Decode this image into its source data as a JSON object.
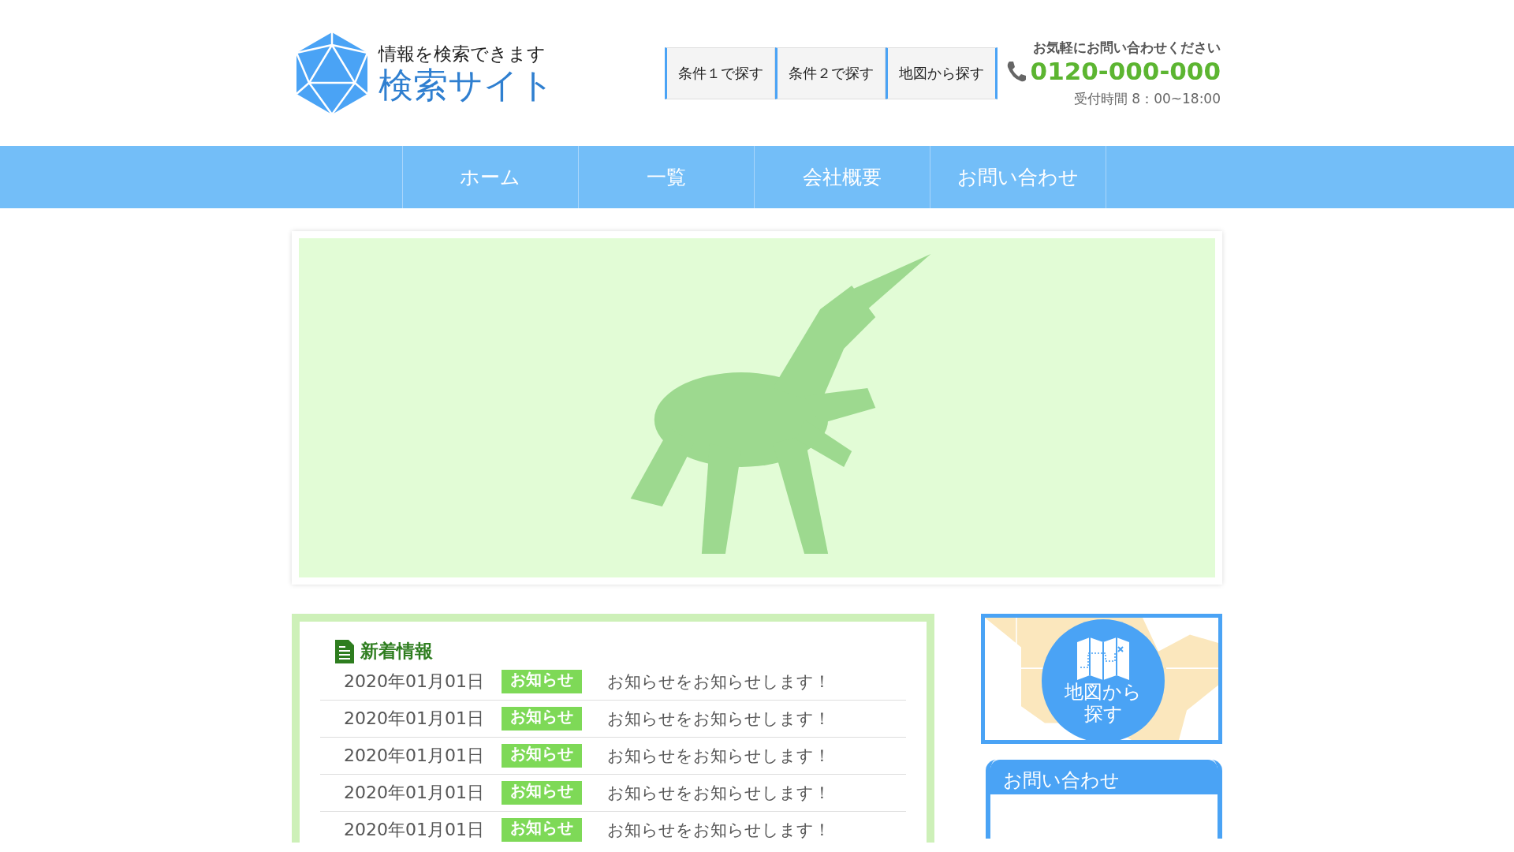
{
  "logo": {
    "tagline": "情報を検索できます",
    "title": "検索サイト"
  },
  "search_buttons": [
    "条件１で探す",
    "条件２で探す",
    "地図から探す"
  ],
  "contact": {
    "lead": "お気軽にお問い合わせください",
    "phone": "0120-000-000",
    "hours": "受付時間 8：00~18:00"
  },
  "nav": [
    {
      "label": "ホーム"
    },
    {
      "label": "一覧"
    },
    {
      "label": "会社概要"
    },
    {
      "label": "お問い合わせ"
    }
  ],
  "banner": {
    "kind": "picture"
  },
  "news": {
    "title": "新着情報",
    "items": [
      {
        "date": "2020年01月01日",
        "tag": "お知らせ",
        "text": "お知らせをお知らせします！"
      },
      {
        "date": "2020年01月01日",
        "tag": "お知らせ",
        "text": "お知らせをお知らせします！"
      },
      {
        "date": "2020年01月01日",
        "tag": "お知らせ",
        "text": "お知らせをお知らせします！"
      },
      {
        "date": "2020年01月01日",
        "tag": "お知らせ",
        "text": "お知らせをお知らせします！"
      },
      {
        "date": "2020年01月01日",
        "tag": "お知らせ",
        "text": "お知らせをお知らせします！"
      }
    ]
  },
  "map_search": {
    "label": "地図から探す"
  },
  "contact_box": {
    "title": "お問い合わせ"
  }
}
